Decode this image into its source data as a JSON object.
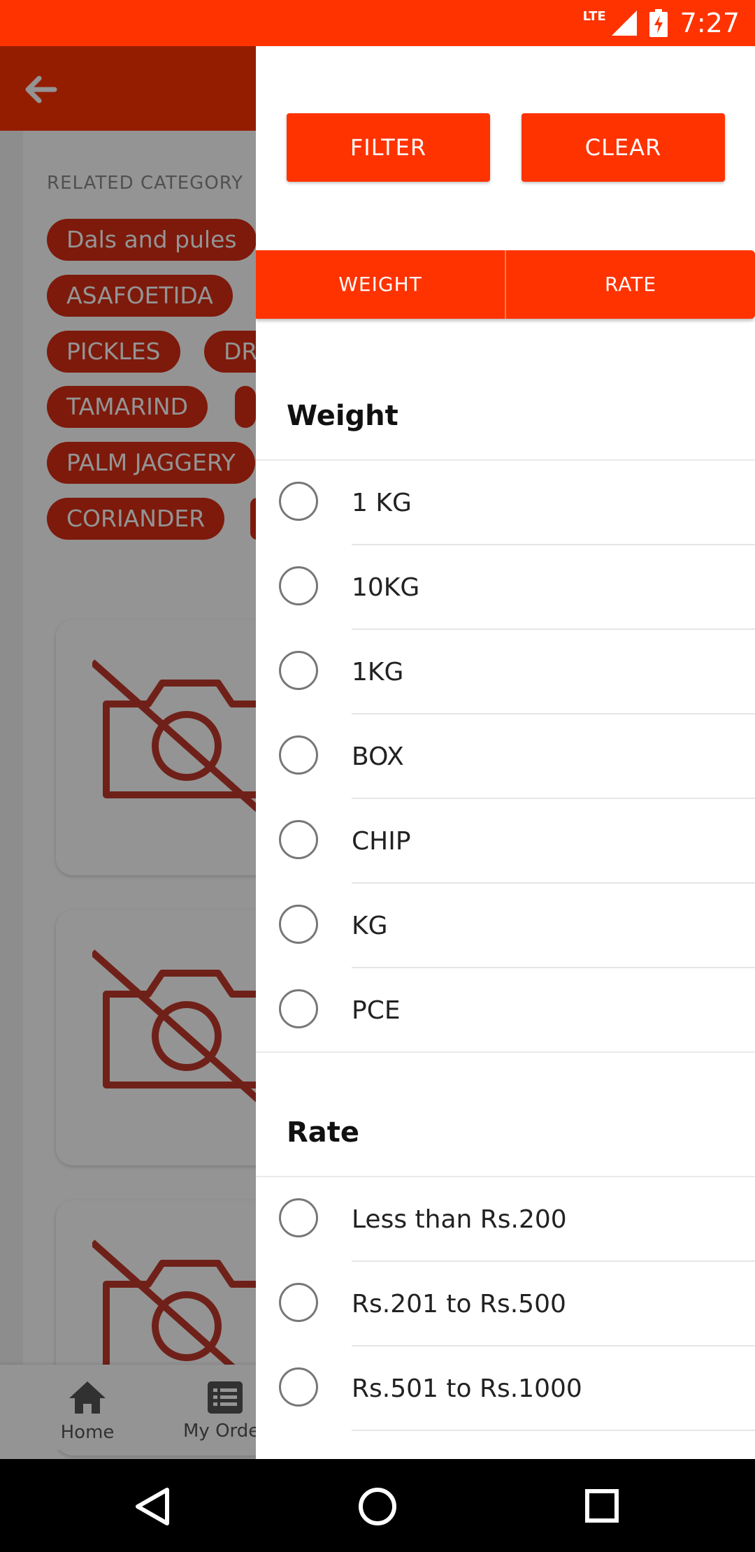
{
  "status_bar": {
    "network": "LTE",
    "time": "7:27"
  },
  "background": {
    "related_label": "RELATED CATEGORY",
    "chips": [
      "Dals and pules",
      "ASAFOETIDA",
      "PICKLES",
      "DR",
      "TAMARIND",
      "PALM JAGGERY",
      "CORIANDER"
    ],
    "bottom_nav": {
      "home": "Home",
      "orders": "My Orders"
    }
  },
  "drawer": {
    "filter_button": "FILTER",
    "clear_button": "CLEAR",
    "tabs": [
      "WEIGHT",
      "RATE"
    ],
    "weight_title": "Weight",
    "weight_options": [
      "1 KG",
      "10KG",
      "1KG",
      "BOX",
      "CHIP",
      "KG",
      "PCE"
    ],
    "rate_title": "Rate",
    "rate_options": [
      "Less than Rs.200",
      "Rs.201 to Rs.500",
      "Rs.501 to Rs.1000"
    ]
  },
  "colors": {
    "accent": "#ff3300",
    "chip": "#d82e14"
  }
}
